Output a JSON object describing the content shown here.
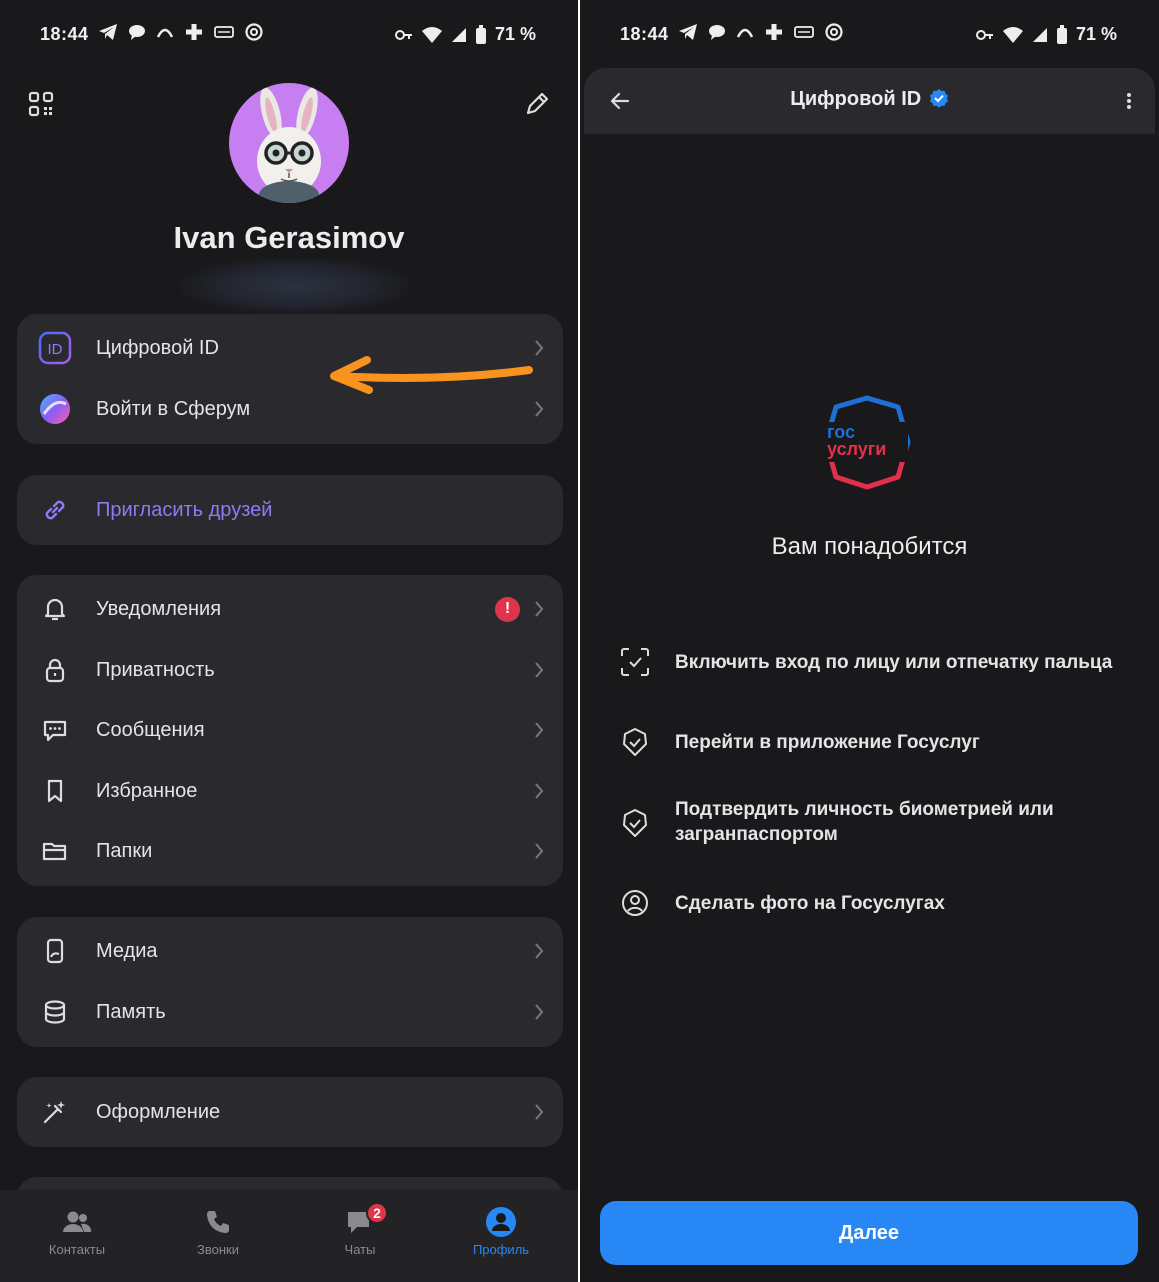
{
  "status": {
    "time": "18:44",
    "battery": "71 %"
  },
  "profile": {
    "name": "Ivan Gerasimov"
  },
  "menu": {
    "group1": [
      {
        "label": "Цифровой ID",
        "icon": "id-icon"
      },
      {
        "label": "Войти в Сферум",
        "icon": "sferum-icon"
      }
    ],
    "invite": {
      "label": "Пригласить друзей",
      "icon": "link-icon"
    },
    "group2": [
      {
        "label": "Уведомления",
        "icon": "bell-icon",
        "alert": "!"
      },
      {
        "label": "Приватность",
        "icon": "lock-icon"
      },
      {
        "label": "Сообщения",
        "icon": "message-icon"
      },
      {
        "label": "Избранное",
        "icon": "bookmark-icon"
      },
      {
        "label": "Папки",
        "icon": "folder-icon"
      }
    ],
    "group3": [
      {
        "label": "Медиа",
        "icon": "media-icon"
      },
      {
        "label": "Память",
        "icon": "storage-icon"
      }
    ],
    "group4": [
      {
        "label": "Оформление",
        "icon": "magic-wand-icon"
      }
    ]
  },
  "tabbar": {
    "tabs": [
      {
        "label": "Контакты",
        "icon": "contacts-icon"
      },
      {
        "label": "Звонки",
        "icon": "phone-icon"
      },
      {
        "label": "Чаты",
        "icon": "chat-icon",
        "badge": "2"
      },
      {
        "label": "Профиль",
        "icon": "profile-icon",
        "active": true
      }
    ]
  },
  "digital_id": {
    "title": "Цифровой ID",
    "logo_text_top": "гос",
    "logo_text_bottom": "услуги",
    "heading": "Вам понадобится",
    "steps": [
      {
        "text": "Включить вход по лицу или отпечатку пальца",
        "icon": "face-scan-icon"
      },
      {
        "text": "Перейти в приложение Госуслуг",
        "icon": "shield-check-icon"
      },
      {
        "text_line1": "Подтвердить личность биометрией или",
        "text_line2": "загранпаспортом",
        "icon": "shield-check-icon"
      },
      {
        "text": "Сделать фото на Госуслугах",
        "icon": "user-circle-icon"
      }
    ],
    "button": "Далее"
  },
  "colors": {
    "accent": "#2787f5",
    "alert": "#e0344a",
    "invite": "#8b7cf6",
    "arrow": "#f7931e",
    "background": "#19191b",
    "card": "#2a2a2e"
  }
}
